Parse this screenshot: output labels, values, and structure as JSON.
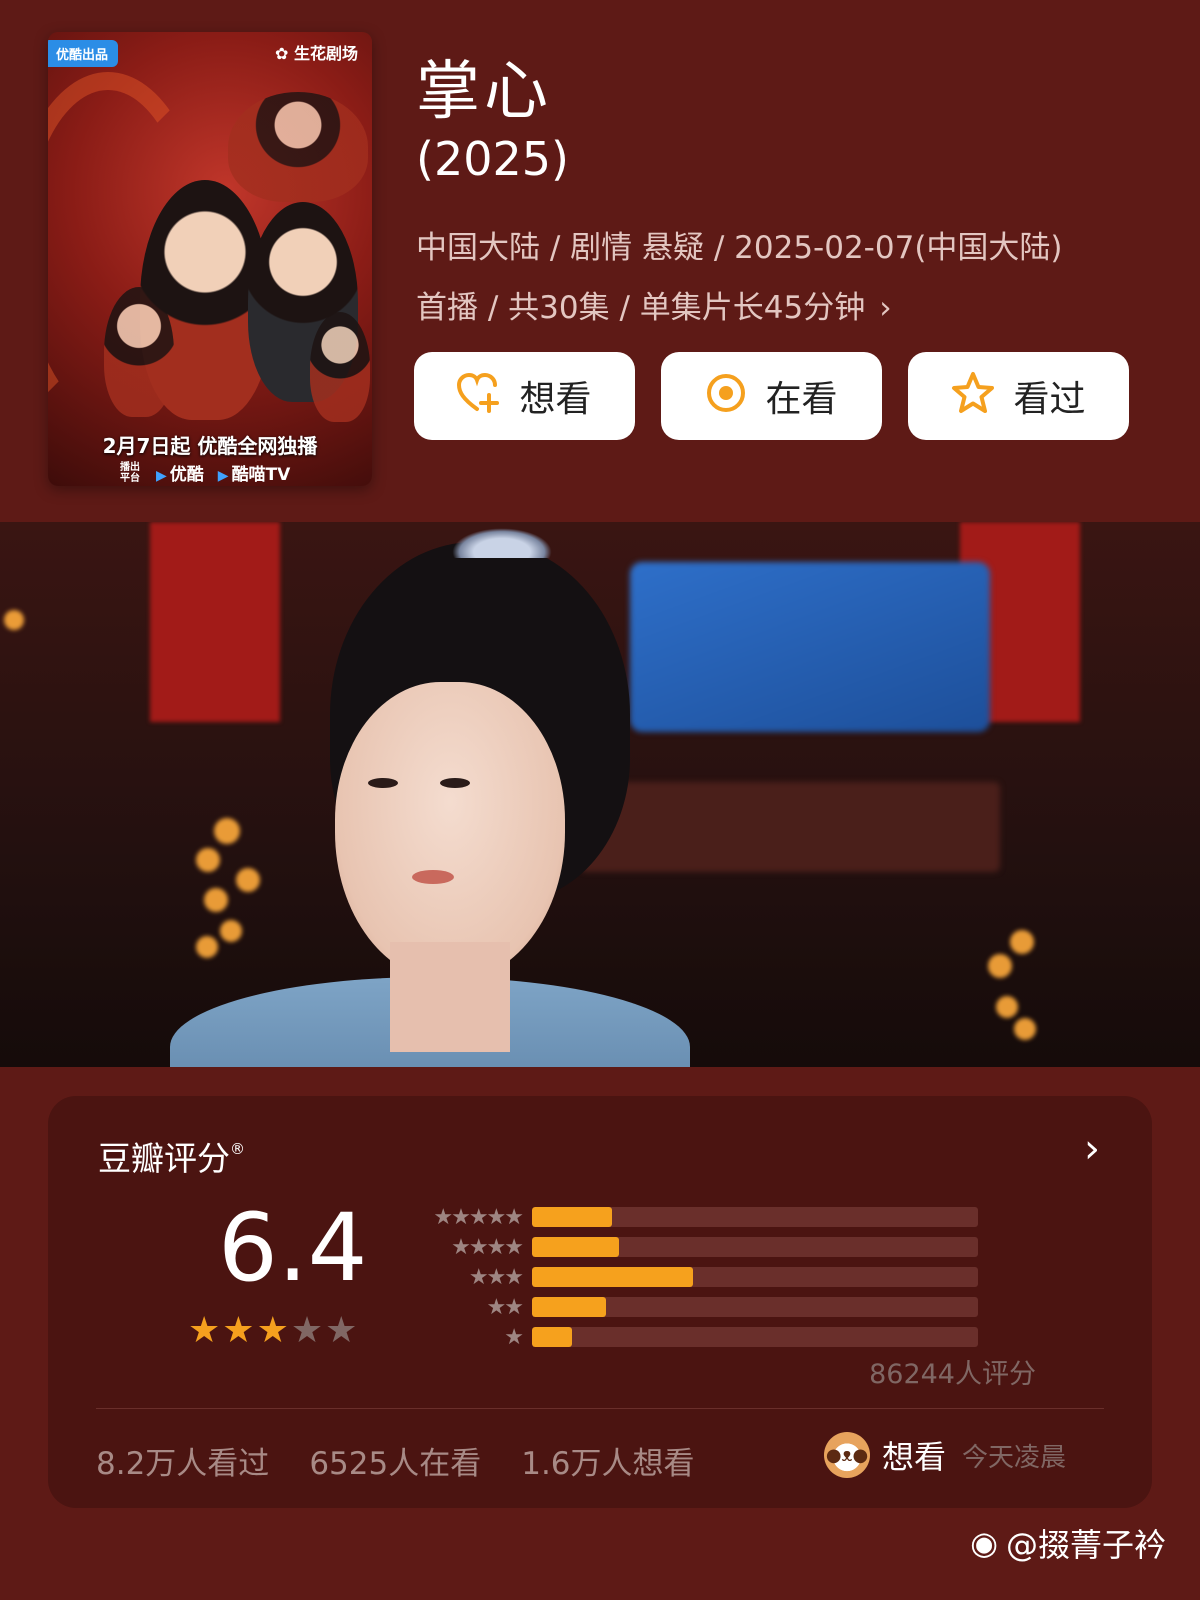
{
  "poster": {
    "badge_left": "优酷出品",
    "badge_right": "生花剧场",
    "release": "2月7日起 优酷全网独播",
    "platform_label": "播出平台",
    "platform_1": "优酷",
    "platform_2": "酷喵TV"
  },
  "header": {
    "title": "掌心",
    "year": "(2025)",
    "meta_line1": "中国大陆 / 剧情 悬疑 / 2025-02-07(中国大陆)",
    "meta_line2": "首播 / 共30集 / 单集片长45分钟"
  },
  "actions": [
    {
      "label": "想看",
      "icon": "heart-plus-icon"
    },
    {
      "label": "在看",
      "icon": "target-icon"
    },
    {
      "label": "看过",
      "icon": "star-icon"
    }
  ],
  "rating": {
    "heading": "豆瓣评分",
    "registered": "®",
    "score": "6.4",
    "stars_on": 3,
    "stars_total": 5,
    "rating_count": "86244人评分",
    "distribution": [
      {
        "stars": "★★★★★",
        "fraction": 0.18
      },
      {
        "stars": "★★★★",
        "fraction": 0.195
      },
      {
        "stars": "★★★",
        "fraction": 0.36
      },
      {
        "stars": "★★",
        "fraction": 0.165
      },
      {
        "stars": "★",
        "fraction": 0.09
      }
    ]
  },
  "stats": {
    "watched": "8.2万人看过",
    "watching": "6525人在看",
    "want": "1.6万人想看"
  },
  "activity": {
    "label": "想看",
    "time": "今天凌晨"
  },
  "watermark": "@掇菁子衿",
  "colors": {
    "background": "#5e1a16",
    "card": "#4b1411",
    "accent": "#f6a11d"
  }
}
